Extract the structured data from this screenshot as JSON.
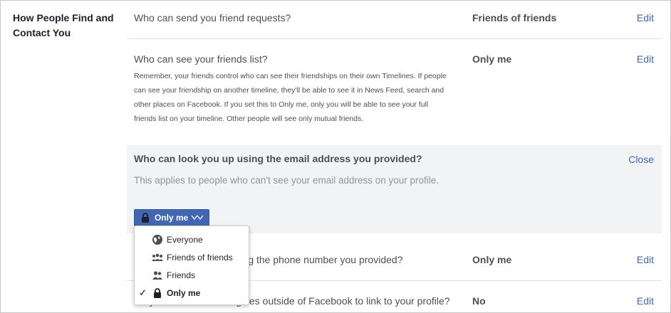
{
  "section": {
    "title": "How People Find and Contact You"
  },
  "rows": [
    {
      "question": "Who can send you friend requests?",
      "value": "Friends of friends",
      "action": "Edit"
    },
    {
      "question": "Who can see your friends list?",
      "value": "Only me",
      "action": "Edit",
      "description": "Remember, your friends control who can see their friendships on their own Timelines. If people can see your friendship on another timeline, they'll be able to see it in News Feed, search and other places on Facebook. If you set this to Only me, only you will be able to see your full friends list on your timeline. Other people will see only mutual friends."
    },
    {
      "question": "Who can look you up using the phone number you provided?",
      "value": "Only me",
      "action": "Edit"
    },
    {
      "question": "Do you want search engines outside of Facebook to link to your profile?",
      "value": "No",
      "action": "Edit"
    }
  ],
  "expanded": {
    "question": "Who can look you up using the email address you provided?",
    "description": "This applies to people who can't see your email address on your profile.",
    "close": "Close",
    "selector_label": "Only me"
  },
  "menu": {
    "items": [
      {
        "label": "Everyone",
        "icon": "globe-icon",
        "selected": false
      },
      {
        "label": "Friends of friends",
        "icon": "friends-of-friends-icon",
        "selected": false
      },
      {
        "label": "Friends",
        "icon": "friends-icon",
        "selected": false
      },
      {
        "label": "Only me",
        "icon": "lock-icon",
        "selected": true
      }
    ],
    "check": "✓"
  },
  "colors": {
    "link": "#4267b2",
    "button": "#4267b2",
    "expanded_bg": "#f2f3f5"
  }
}
